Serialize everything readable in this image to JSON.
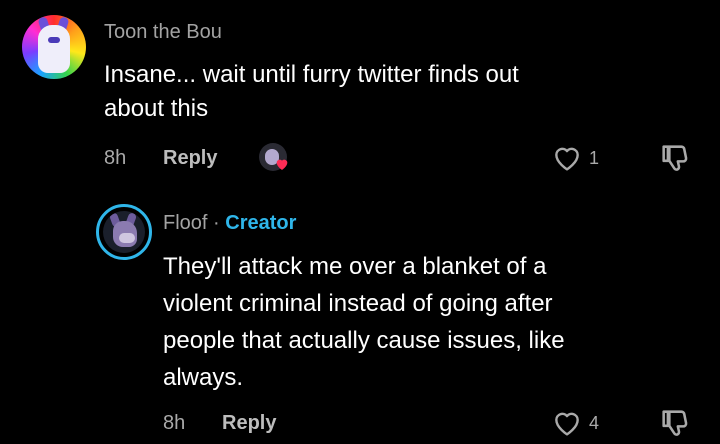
{
  "comments": [
    {
      "username": "Toon the Bou",
      "lines": [
        "Insane... wait until furry twitter finds out",
        "about this"
      ],
      "time": "8h",
      "reply_label": "Reply",
      "like_count": "1"
    },
    {
      "username": "Floof",
      "separator": "·",
      "badge": "Creator",
      "lines": [
        "They'll attack me over a blanket of a",
        "violent criminal instead of going after",
        "people that actually cause issues, like",
        "always."
      ],
      "time": "8h",
      "reply_label": "Reply",
      "like_count": "4"
    }
  ],
  "icons": {
    "like": "heart-outline-icon",
    "dislike": "thumbs-down-icon",
    "creator_liked": "creator-liked-heart-icon"
  },
  "colors": {
    "background": "#000000",
    "creator_accent": "#2fb6ea",
    "liked_heart": "#fe2c55"
  }
}
